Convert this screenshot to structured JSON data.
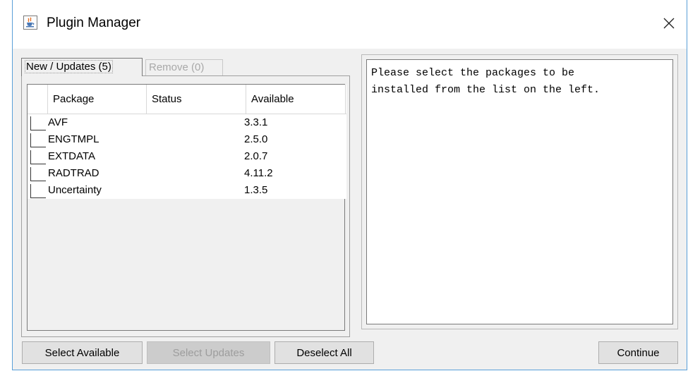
{
  "window": {
    "title": "Plugin Manager",
    "close_glyph": "✕"
  },
  "tabs": [
    {
      "label": "New / Updates (5)",
      "active": true
    },
    {
      "label": "Remove (0)",
      "active": false
    }
  ],
  "table": {
    "columns": [
      "Package",
      "Status",
      "Available"
    ],
    "rows": [
      {
        "package": "AVF",
        "status": "",
        "available": "3.3.1",
        "checked": false
      },
      {
        "package": "ENGTMPL",
        "status": "",
        "available": "2.5.0",
        "checked": false
      },
      {
        "package": "EXTDATA",
        "status": "",
        "available": "2.0.7",
        "checked": false
      },
      {
        "package": "RADTRAD",
        "status": "",
        "available": "4.11.2",
        "checked": false
      },
      {
        "package": "Uncertainty",
        "status": "",
        "available": "1.3.5",
        "checked": false
      }
    ]
  },
  "info": {
    "text": "Please select the packages to be\ninstalled from the list on the left."
  },
  "buttons": {
    "select_available": "Select Available",
    "select_updates": "Select Updates",
    "deselect_all": "Deselect All",
    "continue": "Continue"
  },
  "icons": {
    "app": "java-cup-icon",
    "close": "close-icon"
  }
}
